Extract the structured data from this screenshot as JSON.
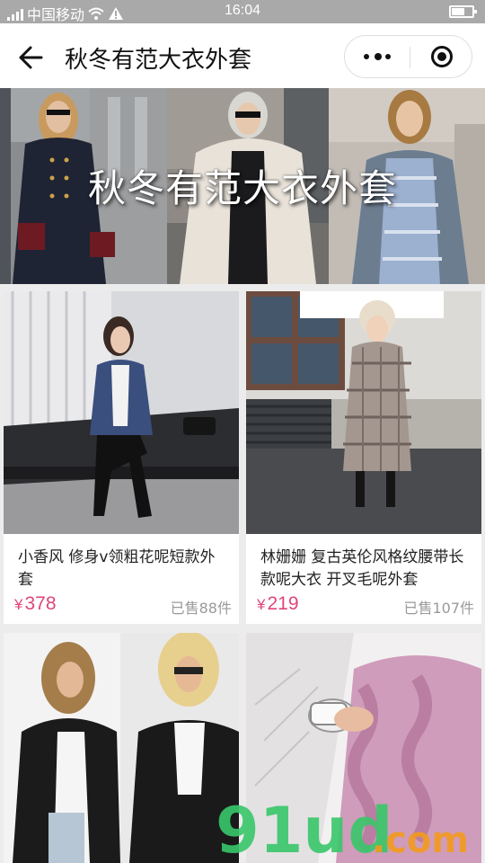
{
  "status_bar": {
    "carrier": "中国移动",
    "time": "16:04"
  },
  "nav": {
    "title": "秋冬有范大衣外套"
  },
  "banner": {
    "title": "秋冬有范大衣外套"
  },
  "products": [
    {
      "name": "小香风 修身v领粗花呢短款外套",
      "currency": "¥",
      "price": "378",
      "sold": "已售88件"
    },
    {
      "name": "林姗姗 复古英伦风格纹腰带长款呢大衣 开叉毛呢外套",
      "currency": "¥",
      "price": "219",
      "sold": "已售107件"
    }
  ],
  "watermark": {
    "brand": "91ud",
    "suffix": ".com"
  },
  "colors": {
    "price": "#e0457b",
    "status_bar": "#a9a9a9",
    "watermark_green": "#39c76a",
    "watermark_orange": "#f39a1e"
  }
}
